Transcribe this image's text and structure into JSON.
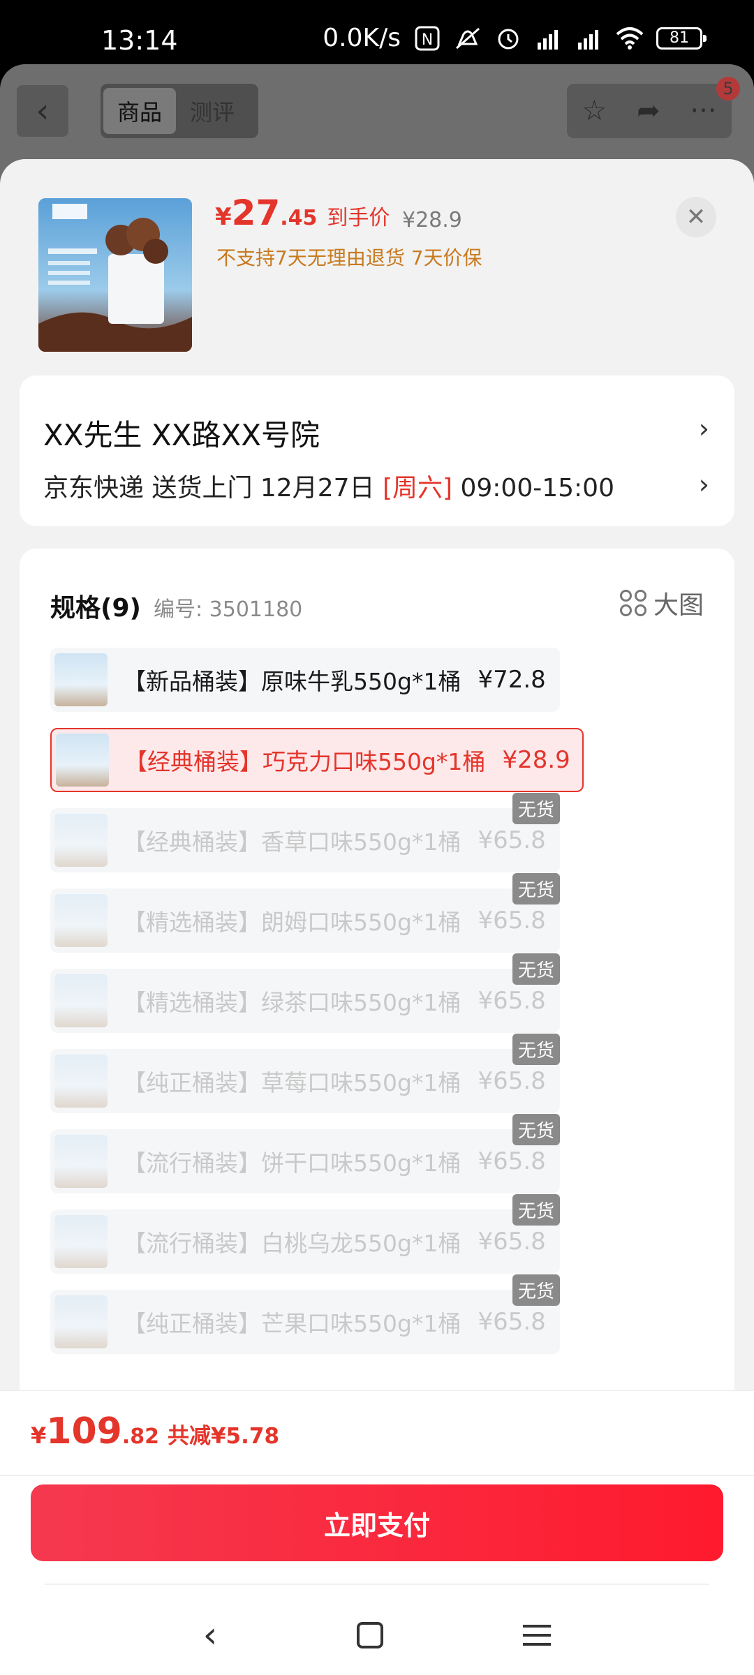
{
  "status_bar": {
    "time": "13:14",
    "speed": "0.0K/s",
    "battery": "81"
  },
  "background": {
    "tabs": [
      "商品",
      "测评"
    ],
    "badge": "5"
  },
  "product": {
    "currency": "¥",
    "price_int": "27",
    "price_dec": ".45",
    "price_label": "到手价",
    "original_price": "¥28.9",
    "policy": "不支持7天无理由退货  7天价保"
  },
  "address": {
    "name_line": "XX先生  XX路XX号院",
    "delivery_prefix": "京东快递 送货上门 12月27日 ",
    "weekday": "[周六]",
    "time_window": " 09:00-15:00"
  },
  "spec": {
    "title": "规格(9)",
    "code": "编号: 3501180",
    "big_pic_label": "大图",
    "no_stock_label": "无货",
    "options": [
      {
        "name": "【新品桶装】原味牛乳550g*1桶",
        "price": "¥72.8",
        "state": "normal"
      },
      {
        "name": "【经典桶装】巧克力口味550g*1桶",
        "price": "¥28.9",
        "state": "selected"
      },
      {
        "name": "【经典桶装】香草口味550g*1桶",
        "price": "¥65.8",
        "state": "disabled"
      },
      {
        "name": "【精选桶装】朗姆口味550g*1桶",
        "price": "¥65.8",
        "state": "disabled"
      },
      {
        "name": "【精选桶装】绿茶口味550g*1桶",
        "price": "¥65.8",
        "state": "disabled"
      },
      {
        "name": "【纯正桶装】草莓口味550g*1桶",
        "price": "¥65.8",
        "state": "disabled"
      },
      {
        "name": "【流行桶装】饼干口味550g*1桶",
        "price": "¥65.8",
        "state": "disabled"
      },
      {
        "name": "【流行桶装】白桃乌龙550g*1桶",
        "price": "¥65.8",
        "state": "disabled"
      },
      {
        "name": "【纯正桶装】芒果口味550g*1桶",
        "price": "¥65.8",
        "state": "disabled"
      }
    ]
  },
  "checkout": {
    "currency": "¥",
    "total_int": "109",
    "total_dec": ".82",
    "saving": "共减¥5.78",
    "pay_label": "立即支付"
  },
  "colors": {
    "accent": "#e4352b",
    "policy": "#c87a1f",
    "pay_button": "#ff1a2e"
  }
}
